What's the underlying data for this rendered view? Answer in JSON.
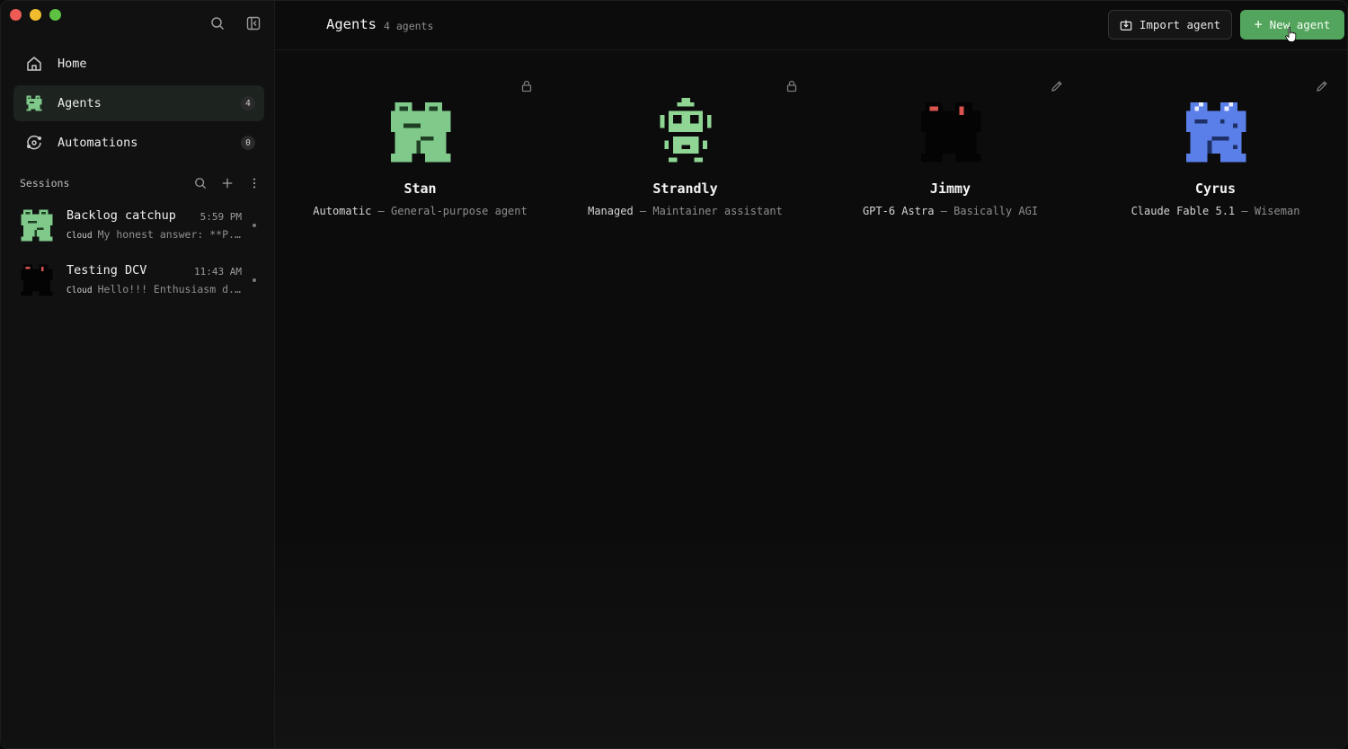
{
  "window": {
    "traffic_lights": [
      "close",
      "minimize",
      "zoom"
    ]
  },
  "sidebar": {
    "nav": [
      {
        "label": "Home",
        "icon": "home-icon",
        "badge": null
      },
      {
        "label": "Agents",
        "icon": "frog-icon",
        "badge": "4",
        "active": true
      },
      {
        "label": "Automations",
        "icon": "automation-icon",
        "badge": "0"
      }
    ],
    "sessions_title": "Sessions",
    "sessions": [
      {
        "title": "Backlog catchup",
        "time": "5:59 PM",
        "tag": "Cloud",
        "preview": "My honest answer: **P..."
      },
      {
        "title": "Testing DCV",
        "time": "11:43 AM",
        "tag": "Cloud",
        "preview": "Hello!!! Enthusiasm d..."
      }
    ]
  },
  "header": {
    "title": "Agents",
    "count": "4 agents",
    "import_label": "Import agent",
    "new_label": "New agent"
  },
  "agents": [
    {
      "name": "Stan",
      "model": "Automatic",
      "sep": " – ",
      "desc": "General-purpose agent",
      "corner": "lock-icon",
      "color": "#7fc98a"
    },
    {
      "name": "Strandly",
      "model": "Managed",
      "sep": " – ",
      "desc": "Maintainer assistant",
      "corner": "lock-icon",
      "color": "#8fd694"
    },
    {
      "name": "Jimmy",
      "model": "GPT-6 Astra",
      "sep": " – ",
      "desc": "Basically AGI",
      "corner": "pencil-icon",
      "color": "#050505"
    },
    {
      "name": "Cyrus",
      "model": "Claude Fable 5.1",
      "sep": " – ",
      "desc": "Wiseman",
      "corner": "pencil-icon",
      "color": "#5b7fe8"
    }
  ],
  "colors": {
    "accent": "#53a45c",
    "active_nav": "#1d241f"
  }
}
